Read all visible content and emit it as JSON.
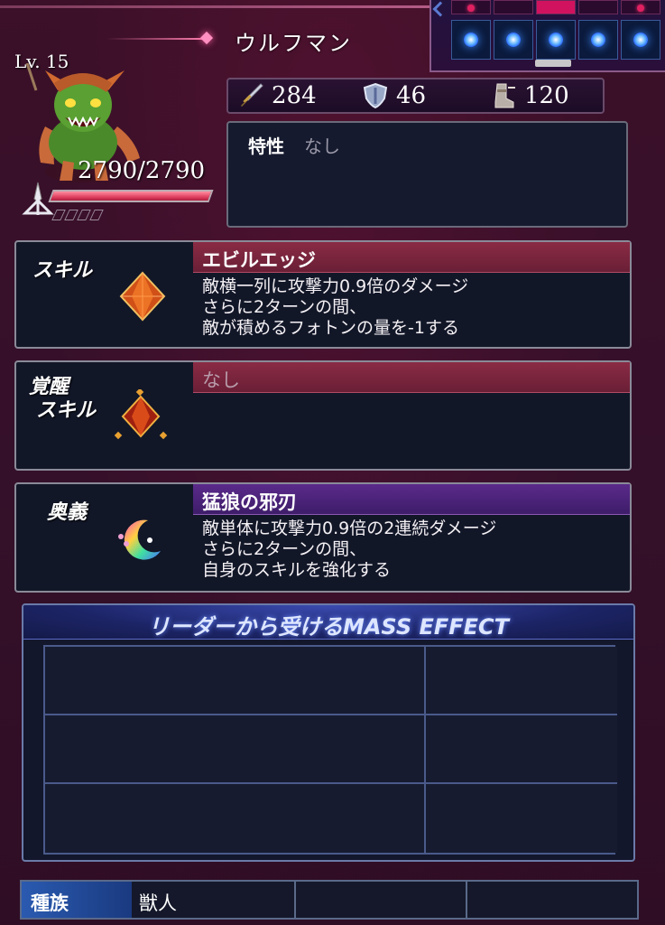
{
  "character": {
    "name": "ウルフマン",
    "level": "Lv. 15",
    "hp": "2790/2790",
    "hp_fraction": 1.0
  },
  "stats": {
    "attack": "284",
    "defense": "46",
    "speed": "120",
    "attack_icon": "sword-icon",
    "defense_icon": "shield-icon",
    "speed_icon": "boot-icon"
  },
  "trait": {
    "label": "特性",
    "value": "なし"
  },
  "skill": {
    "label": "スキル",
    "name": "エビルエッジ",
    "description": [
      "敵横一列に攻撃力0.9倍のダメージ",
      "さらに2ターンの間、",
      "敵が積めるフォトンの量を-1する"
    ]
  },
  "awaken_skill": {
    "label_line1": "覚醒",
    "label_line2": "スキル",
    "name": "なし"
  },
  "ougi": {
    "label": "奥義",
    "name": "猛狼の邪刃",
    "description": [
      "敵単体に攻撃力0.9倍の2連続ダメージ",
      "さらに2ターンの間、",
      "自身のスキルを強化する"
    ]
  },
  "mass_effect": {
    "title": "リーダーから受けるMASS EFFECT"
  },
  "race": {
    "label": "種族",
    "value": "獣人"
  },
  "colors": {
    "background": "#3a0f26",
    "skill_header": "#8a2b45",
    "ougi_header": "#5a2a8a",
    "hp_bar": "#e04060",
    "race_label": "#2a5ab0"
  }
}
